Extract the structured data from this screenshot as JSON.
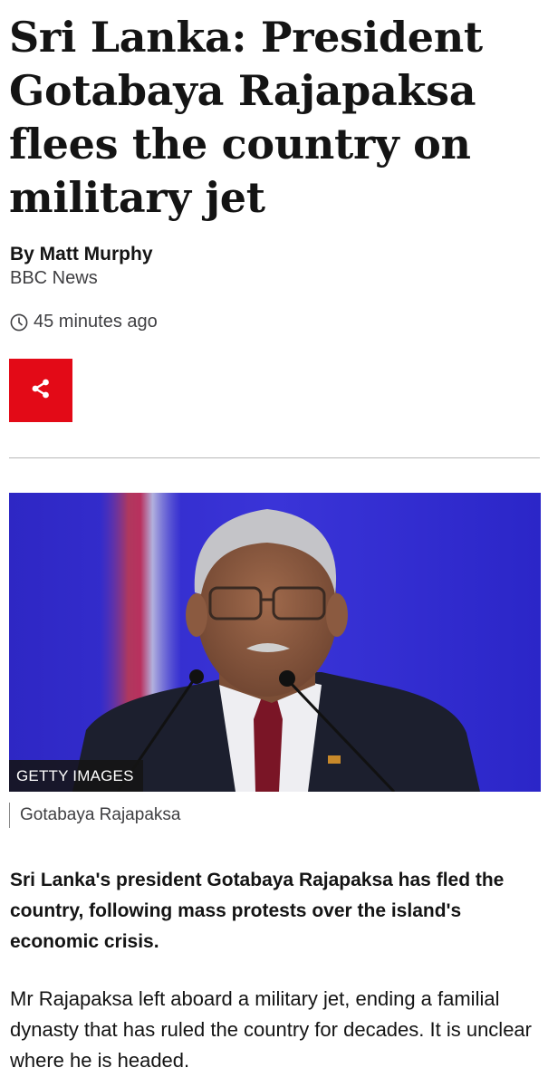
{
  "article": {
    "headline": "Sri Lanka: President Gotabaya Rajapaksa flees the country on military jet",
    "byline": {
      "author": "By Matt Murphy",
      "organisation": "BBC News"
    },
    "timestamp": "45 minutes ago",
    "share_icon": "share-icon",
    "clock_icon": "clock-icon",
    "hero_image": {
      "credit": "GETTY IMAGES",
      "caption": "Gotabaya Rajapaksa"
    },
    "lede": "Sri Lanka's president Gotabaya Rajapaksa has fled the country, following mass protests over the island's economic crisis.",
    "paragraphs": [
      "Mr Rajapaksa left aboard a military jet, ending a familial dynasty that has ruled the country for decades. It is unclear where he is headed."
    ]
  },
  "colors": {
    "share_button": "#e30a17",
    "text": "#141414",
    "muted_text": "#3f3f42",
    "image_background": "#2f2bd0"
  }
}
